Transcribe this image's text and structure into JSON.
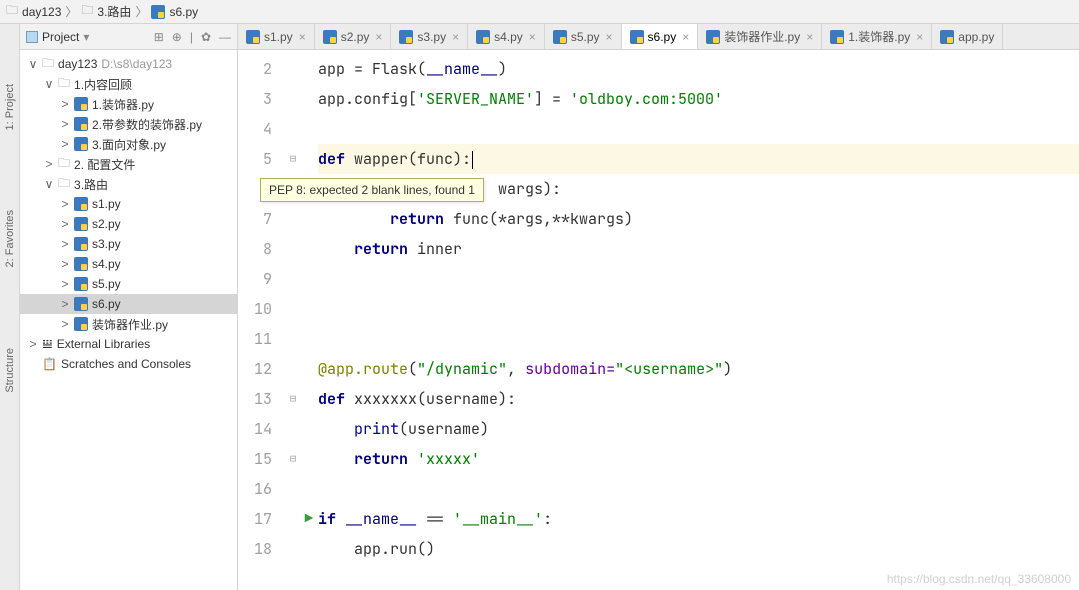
{
  "breadcrumb": [
    {
      "icon": "folder",
      "text": "day123"
    },
    {
      "icon": "folder",
      "text": "3.路由"
    },
    {
      "icon": "py",
      "text": "s6.py"
    }
  ],
  "sidebar_tabs": [
    "1: Project",
    "2: Favorites",
    "Structure"
  ],
  "panel": {
    "title": "Project",
    "tools": [
      "⊞",
      "⊕",
      "|",
      "✿",
      "—"
    ]
  },
  "tree": [
    {
      "ind": 8,
      "chev": "∨",
      "icon": "dir",
      "label": "day123",
      "muted": "D:\\s8\\day123"
    },
    {
      "ind": 24,
      "chev": "∨",
      "icon": "dir",
      "label": "1.内容回顾"
    },
    {
      "ind": 40,
      "chev": ">",
      "icon": "py",
      "label": "1.装饰器.py"
    },
    {
      "ind": 40,
      "chev": ">",
      "icon": "py",
      "label": "2.带参数的装饰器.py"
    },
    {
      "ind": 40,
      "chev": ">",
      "icon": "py",
      "label": "3.面向对象.py"
    },
    {
      "ind": 24,
      "chev": ">",
      "icon": "dir",
      "label": "2. 配置文件"
    },
    {
      "ind": 24,
      "chev": "∨",
      "icon": "dir",
      "label": "3.路由"
    },
    {
      "ind": 40,
      "chev": ">",
      "icon": "py",
      "label": "s1.py"
    },
    {
      "ind": 40,
      "chev": ">",
      "icon": "py",
      "label": "s2.py"
    },
    {
      "ind": 40,
      "chev": ">",
      "icon": "py",
      "label": "s3.py"
    },
    {
      "ind": 40,
      "chev": ">",
      "icon": "py",
      "label": "s4.py"
    },
    {
      "ind": 40,
      "chev": ">",
      "icon": "py",
      "label": "s5.py"
    },
    {
      "ind": 40,
      "chev": ">",
      "icon": "py",
      "label": "s6.py",
      "selected": true
    },
    {
      "ind": 40,
      "chev": ">",
      "icon": "py",
      "label": "装饰器作业.py"
    },
    {
      "ind": 8,
      "chev": ">",
      "icon": "lib",
      "label": "External Libraries"
    },
    {
      "ind": 8,
      "chev": "",
      "icon": "scr",
      "label": "Scratches and Consoles"
    }
  ],
  "tabs": [
    {
      "label": "s1.py"
    },
    {
      "label": "s2.py"
    },
    {
      "label": "s3.py"
    },
    {
      "label": "s4.py"
    },
    {
      "label": "s5.py"
    },
    {
      "label": "s6.py",
      "active": true
    },
    {
      "label": "装饰器作业.py"
    },
    {
      "label": "1.装饰器.py"
    },
    {
      "label": "app.py",
      "noclose": true
    }
  ],
  "tooltip": "PEP 8: expected 2 blank lines, found 1",
  "watermark": "https://blog.csdn.net/qq_33608000",
  "code": {
    "start": 2,
    "fold_at": [
      5,
      6,
      13,
      15
    ],
    "collapse_at": [],
    "run_at": 17,
    "hl": 5,
    "lines": [
      {
        "raw": "app = Flask(__name__)",
        "parts": [
          [
            "",
            "app = Flask("
          ],
          [
            "builtin",
            "__name__"
          ],
          [
            "",
            ")"
          ]
        ]
      },
      {
        "raw": "app.config['SERVER_NAME'] = 'oldboy.com:5000'",
        "parts": [
          [
            "",
            "app.config["
          ],
          [
            "str",
            "'SERVER_NAME'"
          ],
          [
            "",
            "] = "
          ],
          [
            "str",
            "'oldboy.com:5000'"
          ]
        ]
      },
      {
        "raw": "",
        "parts": []
      },
      {
        "raw": "def wapper(func):",
        "cursor": true,
        "parts": [
          [
            "kw",
            "def "
          ],
          [
            "",
            "wapper(func):"
          ]
        ]
      },
      {
        "raw": "    def inner(*args,**kwargs):",
        "parts": [
          [
            "",
            "                    wargs):"
          ]
        ]
      },
      {
        "raw": "        return func(*args,**kwargs)",
        "parts": [
          [
            "",
            "        "
          ],
          [
            "kw",
            "return "
          ],
          [
            "",
            "func(*args,**kwargs)"
          ]
        ]
      },
      {
        "raw": "    return inner",
        "parts": [
          [
            "",
            "    "
          ],
          [
            "kw",
            "return "
          ],
          [
            "",
            "inner"
          ]
        ]
      },
      {
        "raw": "",
        "parts": []
      },
      {
        "raw": "",
        "parts": []
      },
      {
        "raw": "",
        "parts": []
      },
      {
        "raw": "@app.route(\"/dynamic\", subdomain=\"<username>\")",
        "parts": [
          [
            "decorator",
            "@app.route"
          ],
          [
            "",
            "("
          ],
          [
            "str",
            "\"/dynamic\""
          ],
          [
            "",
            ", "
          ],
          [
            "named",
            "subdomain="
          ],
          [
            "str",
            "\"<username>\""
          ],
          [
            "",
            ")"
          ]
        ]
      },
      {
        "raw": "def xxxxxxx(username):",
        "parts": [
          [
            "kw",
            "def "
          ],
          [
            "",
            "xxxxxxx(username):"
          ]
        ]
      },
      {
        "raw": "    print(username)",
        "parts": [
          [
            "",
            "    "
          ],
          [
            "builtin",
            "print"
          ],
          [
            "",
            "(username)"
          ]
        ]
      },
      {
        "raw": "    return 'xxxxx'",
        "parts": [
          [
            "",
            "    "
          ],
          [
            "kw",
            "return "
          ],
          [
            "str",
            "'xxxxx'"
          ]
        ]
      },
      {
        "raw": "",
        "parts": []
      },
      {
        "raw": "if __name__ == '__main__':",
        "parts": [
          [
            "kw",
            "if "
          ],
          [
            "builtin",
            "__name__"
          ],
          [
            "",
            " == "
          ],
          [
            "str",
            "'__main__'"
          ],
          [
            "",
            ":"
          ]
        ]
      },
      {
        "raw": "    app.run()",
        "parts": [
          [
            "",
            "    app.run()"
          ]
        ]
      }
    ]
  }
}
